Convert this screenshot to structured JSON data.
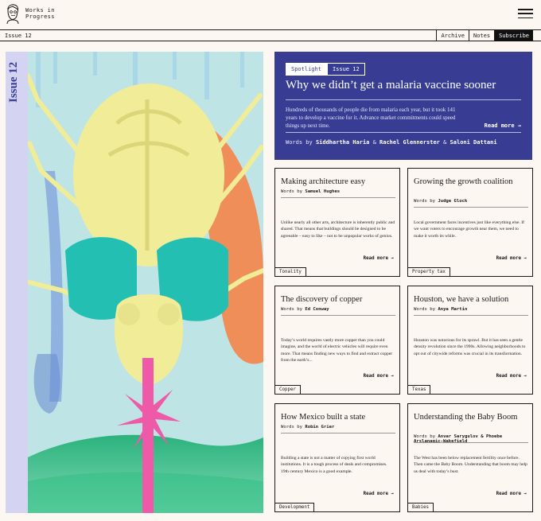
{
  "header": {
    "logo_text": "Works in Progress",
    "issue": "Issue 12",
    "nav": [
      "Archive",
      "Notes"
    ],
    "subscribe": "Subscribe"
  },
  "hero": {
    "issue_label": "Issue 12"
  },
  "spotlight": {
    "chips": [
      "Spotlight",
      "Issue 12"
    ],
    "title": "Why we didn’t get a malaria vaccine sooner",
    "summary": "Hundreds of thousands of people die from malaria each year, but it took 141 years to develop a vaccine for it. Advance market commitments could speed things up next time.",
    "read_more": "Read more →",
    "words_label": "Words by",
    "authors": [
      "Siddhartha Haria",
      "Rachel Glennerster",
      "Saloni Dattani"
    ],
    "amp": "&"
  },
  "cards": [
    {
      "title": "Making architecture easy",
      "words_label": "Words by",
      "author": "Samuel Hughes",
      "summary": "Unlike nearly all other arts, architecture is inherently public and shared. That means that buildings should be designed to be agreeable – easy to like – not to be unpopular works of genius.",
      "read_more": "Read more →",
      "tag": "Tonality"
    },
    {
      "title": "Growing the growth coalition",
      "words_label": "Words by",
      "author": "Judge Glock",
      "summary": "Local government faces incentives just like everything else. If we want voters to encourage growth near them, we need to make it worth its while.",
      "read_more": "Read more →",
      "tag": "Property tax"
    },
    {
      "title": "The discovery of copper",
      "words_label": "Words by",
      "author": "Ed Conway",
      "summary": "Today’s world requires vastly more copper than you could imagine, and the world of electric vehicles will require even more. That means finding new ways to find and extract copper from the earth’s...",
      "read_more": "Read more →",
      "tag": "Copper"
    },
    {
      "title": "Houston, we have a solution",
      "words_label": "Words by",
      "author": "Anya Martin",
      "summary": "Houston was notorious for its sprawl. But it has seen a gentle density revolution since the 1990s. Allowing neighborhoods to opt out of citywide reforms was crucial in its transformation.",
      "read_more": "Read more →",
      "tag": "Texas"
    },
    {
      "title": "How Mexico built a state",
      "words_label": "Words by",
      "author": "Robin Grier",
      "summary": "Building a state is not a matter of copying first world institutions. It is a tough process of deals and compromises. 19th century Mexico is a good example.",
      "read_more": "Read more →",
      "tag": "Development"
    },
    {
      "title": "Understanding the Baby Boom",
      "words_label": "Words by",
      "author": "Anvar Sarygulov & Phoebe Arslanagic-Wakefield",
      "summary": "The West has been below replacement fertility once before. Then came the Baby Boom. Understanding that boom may help us deal with today’s bust.",
      "read_more": "Read more →",
      "tag": "Babies"
    }
  ]
}
